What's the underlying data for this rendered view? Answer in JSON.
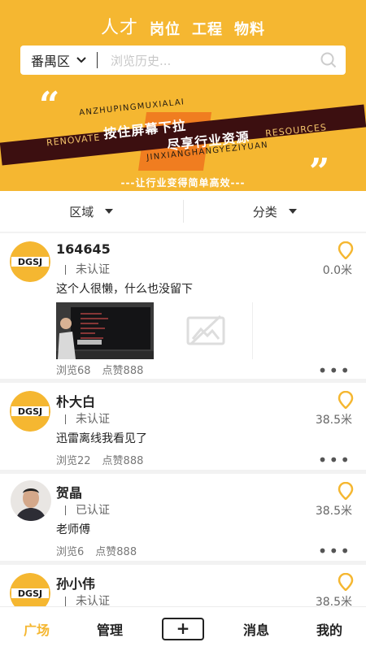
{
  "header": {
    "tabs": [
      {
        "label": "人才"
      },
      {
        "label": "岗位"
      },
      {
        "label": "工程"
      },
      {
        "label": "物料"
      }
    ],
    "search": {
      "region": "番禺区",
      "placeholder": "浏览历史..."
    },
    "banner": {
      "en_top": "ANZHUPINGMUXIALAI",
      "en_bottom": "JINXIANGHANGYEZIYUAN",
      "left_word": "RENOVATE",
      "right_word": "RESOURCES",
      "cn_line1": "按住屏幕下拉",
      "cn_line2": "尽享行业资源",
      "quote_open": "“",
      "quote_close": "”",
      "slogan": "---让行业变得简单高效---"
    }
  },
  "filters": {
    "area": "区域",
    "category": "分类"
  },
  "logo_text": "DGSJ",
  "posts": [
    {
      "name": "164645",
      "cert": "未认证",
      "distance": "0.0米",
      "content": "这个人很懒，什么也没留下",
      "views": "浏览68",
      "likes": "点赞888",
      "has_media": true
    },
    {
      "name": "朴大白",
      "cert": "未认证",
      "distance": "38.5米",
      "content": "迅雷离线我看见了",
      "views": "浏览22",
      "likes": "点赞888"
    },
    {
      "name": "贺晶",
      "cert": "已认证",
      "distance": "38.5米",
      "content": "老师傅",
      "views": "浏览6",
      "likes": "点赞888"
    },
    {
      "name": "孙小伟",
      "cert": "未认证",
      "distance": "38.5米"
    }
  ],
  "more_label": "•••",
  "tabbar": {
    "square": "广场",
    "manage": "管理",
    "plus": "+",
    "messages": "消息",
    "mine": "我的"
  },
  "colors": {
    "accent": "#f5b731",
    "banner_band": "#3c0f10",
    "orange": "#f07d20"
  }
}
